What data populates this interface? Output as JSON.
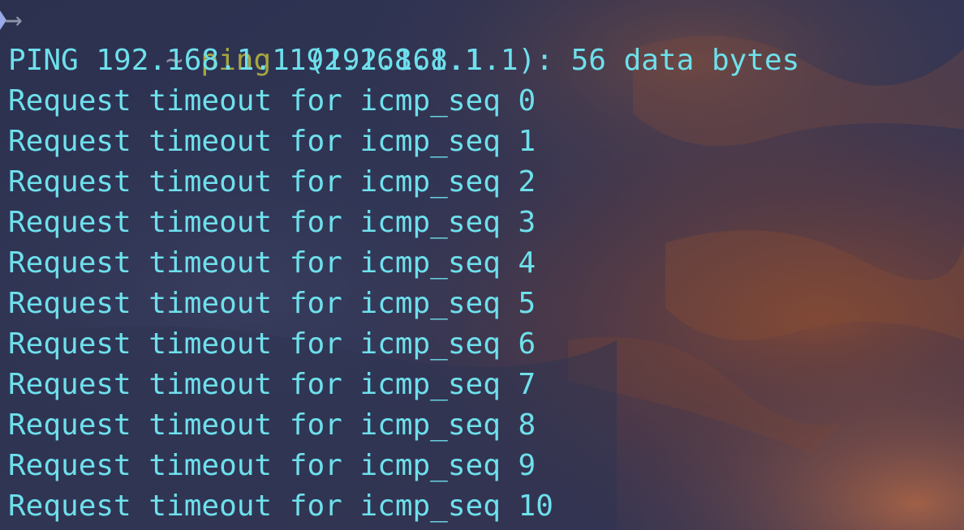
{
  "terminal": {
    "prompt": {
      "arrow_icon": "arrow-right-icon",
      "directory": "~",
      "command": "ping",
      "argument": "192.168.1.1"
    },
    "header_line": "PING 192.168.1.1 (192.168.1.1): 56 data bytes",
    "output_lines": [
      "Request timeout for icmp_seq 0",
      "Request timeout for icmp_seq 1",
      "Request timeout for icmp_seq 2",
      "Request timeout for icmp_seq 3",
      "Request timeout for icmp_seq 4",
      "Request timeout for icmp_seq 5",
      "Request timeout for icmp_seq 6",
      "Request timeout for icmp_seq 7",
      "Request timeout for icmp_seq 8",
      "Request timeout for icmp_seq 9",
      "Request timeout for icmp_seq 10"
    ]
  },
  "colors": {
    "output_text": "#6ee0ec",
    "command_text": "#a7a63e",
    "directory_text": "#8f93a6",
    "prompt_marker": "#9aa9e8"
  }
}
